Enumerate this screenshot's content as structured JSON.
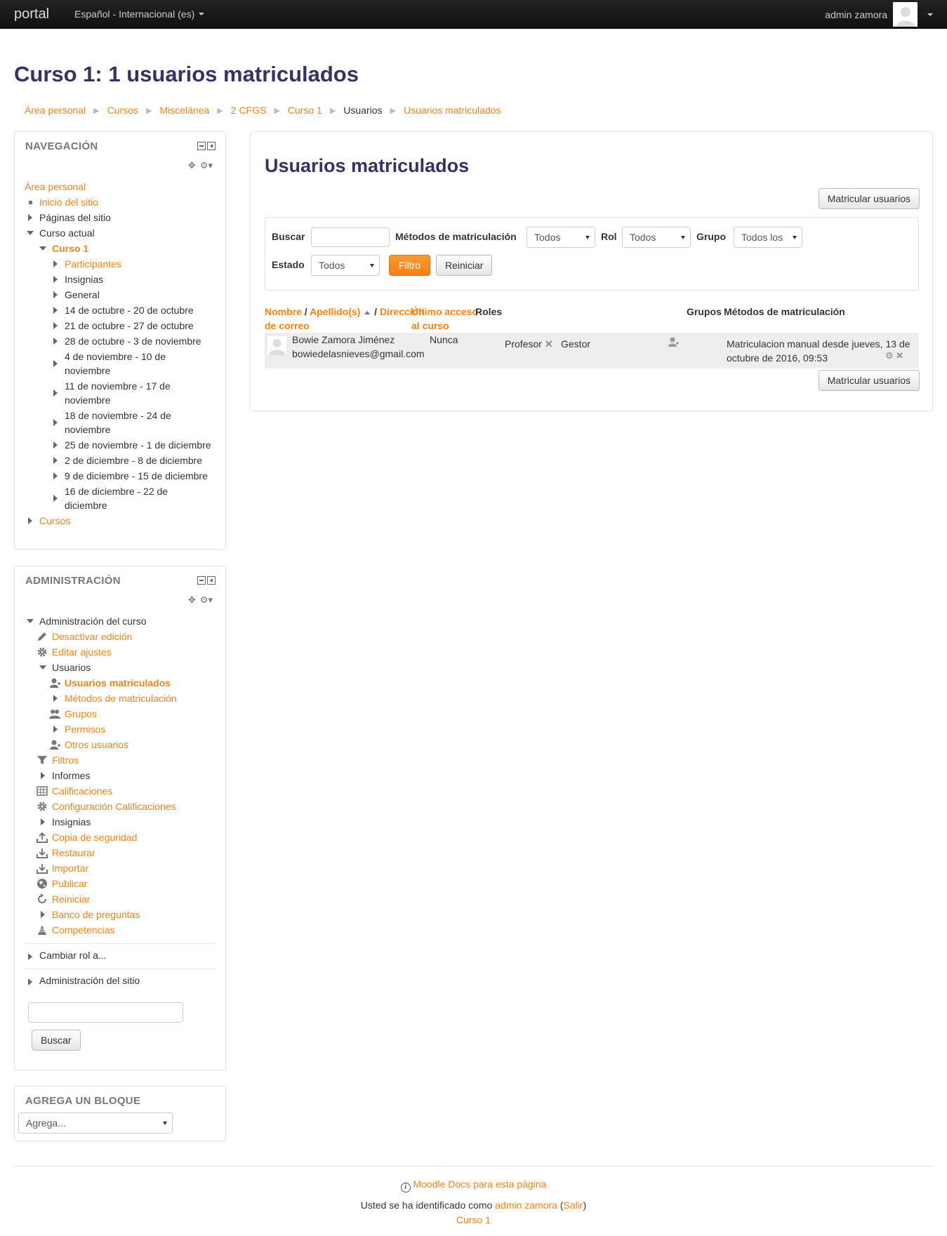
{
  "navbar": {
    "brand": "portal",
    "language": "Español - Internacional (es)",
    "user_name": "admin zamora"
  },
  "page": {
    "title": "Curso 1: 1 usuarios matriculados"
  },
  "breadcrumb": [
    {
      "label": "Área personal",
      "link": true
    },
    {
      "label": "Cursos",
      "link": true
    },
    {
      "label": "Miscelánea",
      "link": true
    },
    {
      "label": "2 CFGS",
      "link": true
    },
    {
      "label": "Curso 1",
      "link": true
    },
    {
      "label": "Usuarios",
      "link": false
    },
    {
      "label": "Usuarios matriculados",
      "link": true
    }
  ],
  "navigation": {
    "title": "NAVEGACIÓN",
    "items": {
      "area_personal": "Área personal",
      "inicio_sitio": "Inicio del sitio",
      "paginas_sitio": "Páginas del sitio",
      "curso_actual": "Curso actual",
      "curso1": "Curso 1",
      "participantes": "Participantes",
      "insignias": "Insignias",
      "general": "General",
      "w1": "14 de octubre - 20 de octubre",
      "w2": "21 de octubre - 27 de octubre",
      "w3": "28 de octubre - 3 de noviembre",
      "w4": "4 de noviembre - 10 de noviembre",
      "w5": "11 de noviembre - 17 de noviembre",
      "w6": "18 de noviembre - 24 de noviembre",
      "w7": "25 de noviembre - 1 de diciembre",
      "w8": "2 de diciembre - 8 de diciembre",
      "w9": "9 de diciembre - 15 de diciembre",
      "w10": "16 de diciembre - 22 de diciembre",
      "cursos": "Cursos"
    }
  },
  "administration": {
    "title": "ADMINISTRACIÓN",
    "items": {
      "admin_curso": "Administración del curso",
      "desactivar_edicion": "Desactivar edición",
      "editar_ajustes": "Editar ajustes",
      "usuarios": "Usuarios",
      "usuarios_matriculados": "Usuarios matriculados",
      "metodos_matriculacion": "Métodos de matriculación",
      "grupos": "Grupos",
      "permisos": "Permisos",
      "otros_usuarios": "Otros usuarios",
      "filtros": "Filtros",
      "informes": "Informes",
      "calificaciones": "Calificaciones",
      "config_calificaciones": "Configuración Calificaciones",
      "insignias": "Insignias",
      "copia_seguridad": "Copia de seguridad",
      "restaurar": "Restaurar",
      "importar": "Importar",
      "publicar": "Publicar",
      "reiniciar": "Reiniciar",
      "banco_preguntas": "Banco de preguntas",
      "competencias": "Competencias",
      "cambiar_rol": "Cambiar rol a...",
      "admin_sitio": "Administración del sitio"
    },
    "search_value": "",
    "search_button": "Buscar"
  },
  "add_block": {
    "title": "AGREGA UN BLOQUE",
    "select_value": "Agrega..."
  },
  "main": {
    "heading": "Usuarios matriculados",
    "enrol_button": "Matricular usuarios",
    "filters": {
      "search_label": "Buscar",
      "search_value": "",
      "methods_label": "Métodos de matriculación",
      "methods_value": "Todos",
      "role_label": "Rol",
      "role_value": "Todos",
      "group_label": "Grupo",
      "group_value": "Todos los",
      "status_label": "Estado",
      "status_value": "Todos",
      "filter_button": "Filtro",
      "reset_button": "Reiniciar"
    },
    "table": {
      "headers": {
        "nombre": "Nombre",
        "slash1": " / ",
        "apellidos": "Apellido(s)",
        "slash2": " / ",
        "email_a": "Dirección",
        "email_b": "de correo",
        "last_access_a": "Último acceso",
        "last_access_b": "al curso",
        "roles": "Roles",
        "groups": "Grupos",
        "methods": "Métodos de matriculación"
      },
      "row": {
        "name": "Bowie Zamora Jiménez",
        "email": "bowiedelasnieves@gmail.com",
        "last_access": "Nunca",
        "role1": "Profesor",
        "role2": "Gestor",
        "method_a": "Matriculacion manual desde jueves, 13 de",
        "method_b": "octubre de 2016, 09:53"
      }
    }
  },
  "footer": {
    "docs_link": "Moodle Docs para esta página",
    "logged_prefix": "Usted se ha identificado como ",
    "logged_user": "admin zamora",
    "paren_open": " (",
    "logout": "Salir",
    "paren_close": ")",
    "course_link": "Curso 1"
  },
  "colors": {
    "accent": "#f98012",
    "heading": "#333366"
  }
}
